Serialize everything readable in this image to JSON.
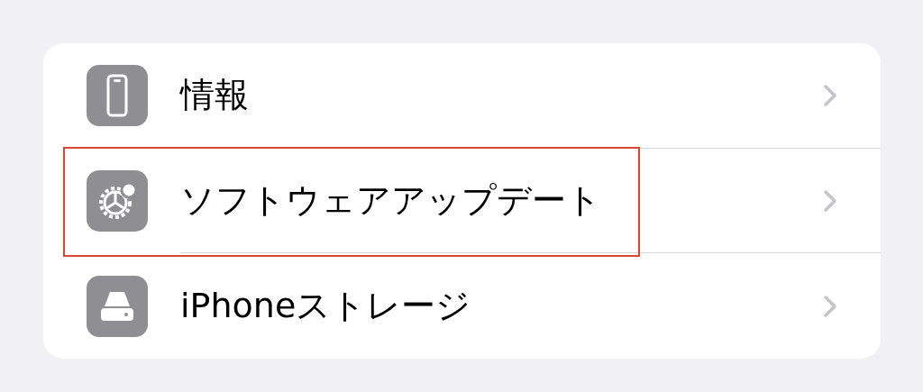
{
  "settings_list": [
    {
      "kind": "phone",
      "label": "情報",
      "highlighted": false
    },
    {
      "kind": "gear",
      "label": "ソフトウェアアップデート",
      "highlighted": true
    },
    {
      "kind": "drive",
      "label": "iPhoneストレージ",
      "highlighted": false
    }
  ]
}
